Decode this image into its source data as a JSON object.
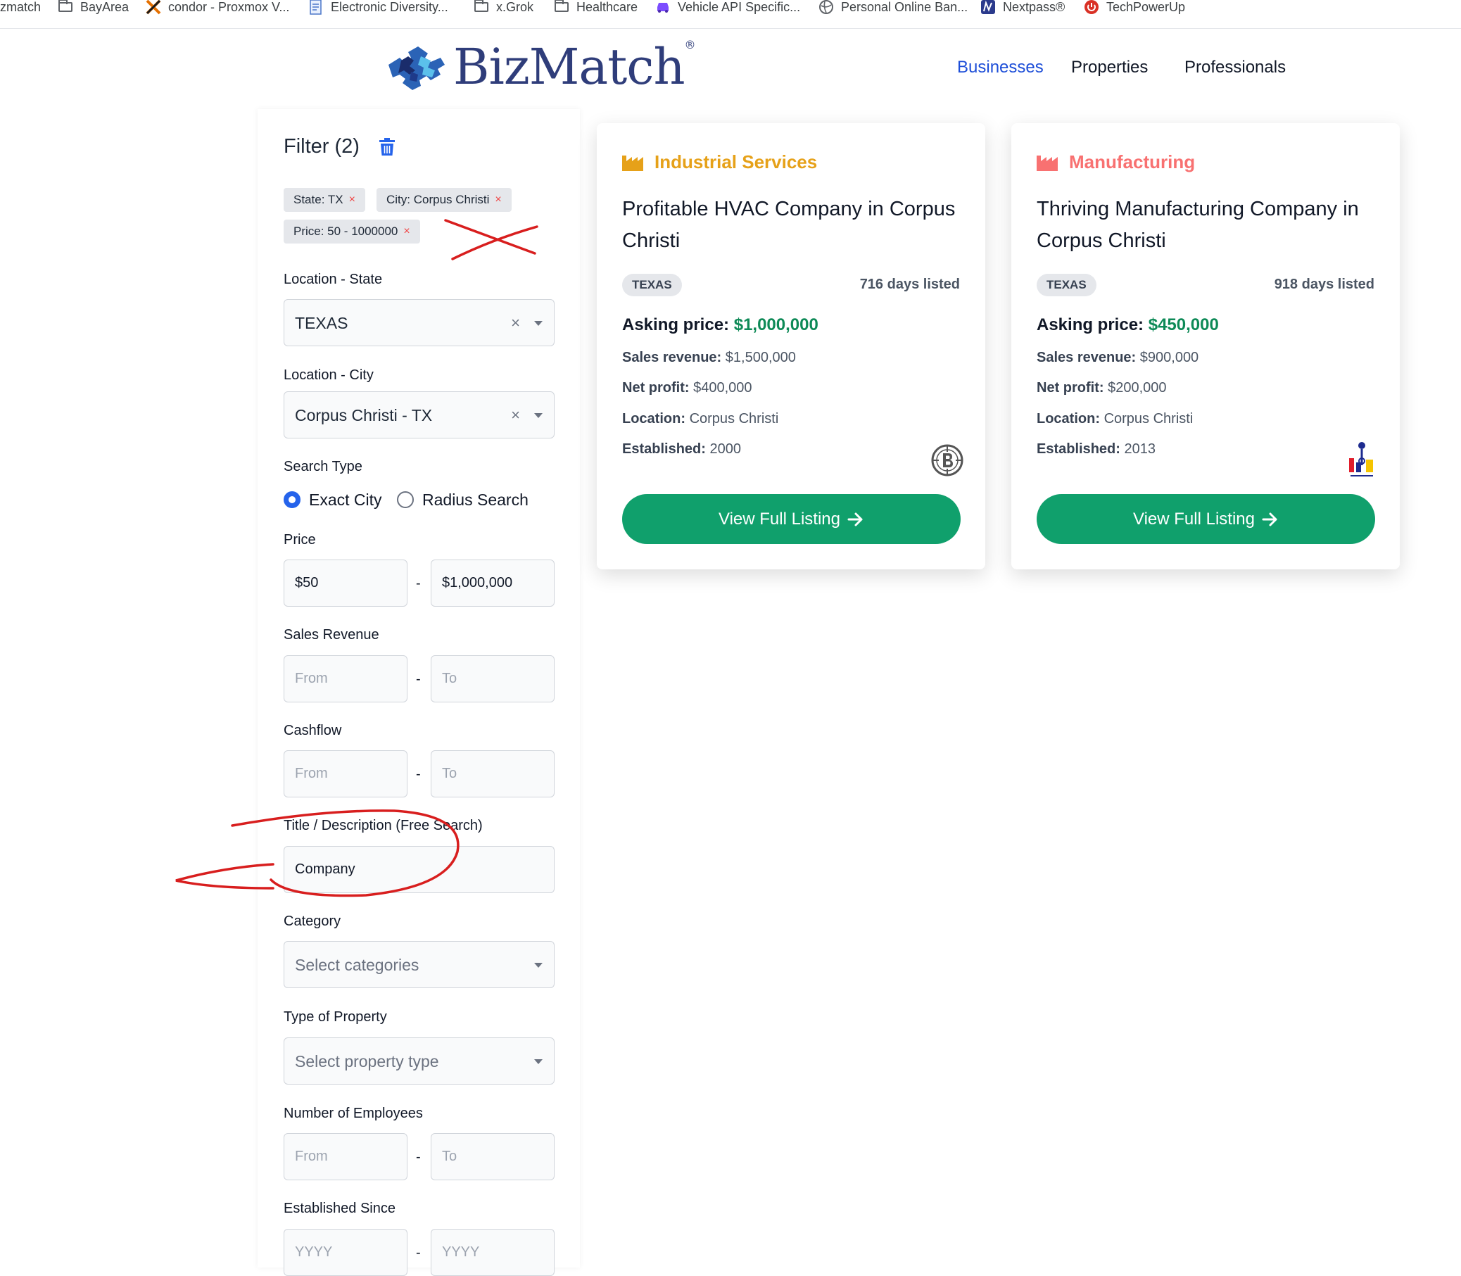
{
  "bookmarks": [
    {
      "label": "zmatch",
      "icon": "none"
    },
    {
      "label": "BayArea",
      "icon": "folder-icon"
    },
    {
      "label": "condor - Proxmox V...",
      "icon": "proxmox-icon"
    },
    {
      "label": "Electronic Diversity...",
      "icon": "document-icon"
    },
    {
      "label": "x.Grok",
      "icon": "folder-icon"
    },
    {
      "label": "Healthcare",
      "icon": "folder-icon"
    },
    {
      "label": "Vehicle API Specific...",
      "icon": "car-icon"
    },
    {
      "label": "Personal Online Ban...",
      "icon": "globe-icon"
    },
    {
      "label": "Nextpass®",
      "icon": "nextpass-icon"
    },
    {
      "label": "TechPowerUp",
      "icon": "power-icon"
    }
  ],
  "header": {
    "logo_text": "BizMatch",
    "logo_mark": "®",
    "nav": [
      "Businesses",
      "Properties",
      "Professionals"
    ],
    "active_nav": "Businesses"
  },
  "colors": {
    "accent_blue": "#1d4ed8",
    "green_button": "#10a06c",
    "price_green": "#0e8a57",
    "industrial": "#e6a119",
    "manufacturing": "#f87171",
    "annotation_red": "#d81e1e"
  },
  "filter": {
    "title": "Filter (2)",
    "chips": [
      {
        "label": "State: TX",
        "x": "×"
      },
      {
        "label": "City: Corpus Christi",
        "x": "×"
      },
      {
        "label": "Price: 50 - 1000000",
        "x": "×"
      }
    ],
    "state_label": "Location - State",
    "state_value": "TEXAS",
    "city_label": "Location - City",
    "city_value": "Corpus Christi - TX",
    "clear_symbol": "×",
    "search_type_label": "Search Type",
    "search_types": [
      "Exact City",
      "Radius Search"
    ],
    "search_type_selected": "Exact City",
    "dash": "-",
    "price_label": "Price",
    "price_from": "$50",
    "price_to": "$1,000,000",
    "sales_label": "Sales Revenue",
    "cashflow_label": "Cashflow",
    "from_ph": "From",
    "to_ph": "To",
    "free_label": "Title / Description (Free Search)",
    "free_value": "Company",
    "category_label": "Category",
    "category_ph": "Select categories",
    "property_label": "Type of Property",
    "property_ph": "Select property type",
    "employees_label": "Number of Employees",
    "established_label": "Established Since",
    "year_ph": "YYYY"
  },
  "listings": [
    {
      "category": "Industrial Services",
      "title": "Profitable HVAC Company in Corpus Christi",
      "state": "TEXAS",
      "days": "716 days listed",
      "asking_label": "Asking price:",
      "asking": "$1,000,000",
      "sales_label": "Sales revenue:",
      "sales": "$1,500,000",
      "profit_label": "Net profit:",
      "profit": "$400,000",
      "location_label": "Location:",
      "location": "Corpus Christi",
      "established_label": "Established:",
      "established": "2000",
      "button": "View Full Listing"
    },
    {
      "category": "Manufacturing",
      "title": "Thriving Manufacturing Company in Corpus Christi",
      "state": "TEXAS",
      "days": "918 days listed",
      "asking_label": "Asking price:",
      "asking": "$450,000",
      "sales_label": "Sales revenue:",
      "sales": "$900,000",
      "profit_label": "Net profit:",
      "profit": "$200,000",
      "location_label": "Location:",
      "location": "Corpus Christi",
      "established_label": "Established:",
      "established": "2013",
      "button": "View Full Listing"
    }
  ]
}
